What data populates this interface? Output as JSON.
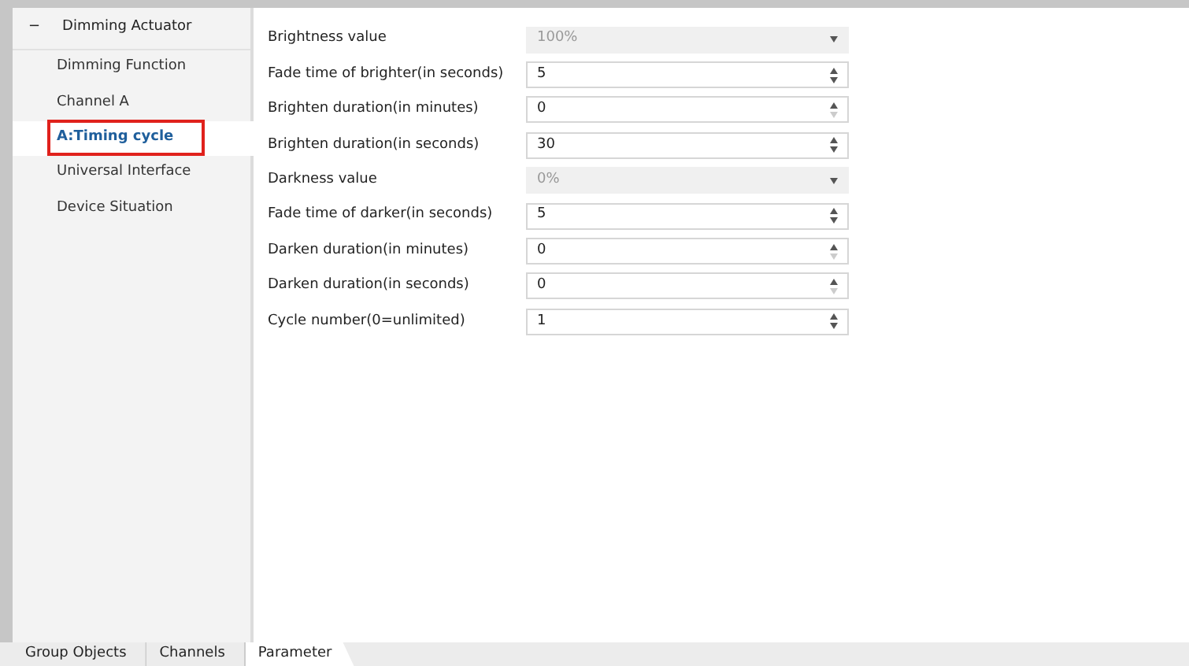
{
  "sidebar": {
    "header": {
      "toggle": "−",
      "label": "Dimming Actuator"
    },
    "items": [
      {
        "label": "Dimming Function",
        "selected": false,
        "highlighted": false
      },
      {
        "label": "Channel A",
        "selected": false,
        "highlighted": false
      },
      {
        "label": "A:Timing cycle",
        "selected": true,
        "highlighted": true
      },
      {
        "label": "Universal Interface",
        "selected": false,
        "highlighted": false
      },
      {
        "label": "Device Situation",
        "selected": false,
        "highlighted": false
      }
    ]
  },
  "parameters": [
    {
      "kind": "select",
      "label": "Brightness value",
      "value": "100%",
      "disabled": true
    },
    {
      "kind": "spin",
      "label": "Fade time of brighter(in seconds)",
      "value": "5",
      "down_disabled": false
    },
    {
      "kind": "spin",
      "label": "Brighten duration(in minutes)",
      "value": "0",
      "down_disabled": true
    },
    {
      "kind": "spin",
      "label": "Brighten duration(in seconds)",
      "value": "30",
      "down_disabled": false
    },
    {
      "kind": "select",
      "label": "Darkness value",
      "value": "0%",
      "disabled": true
    },
    {
      "kind": "spin",
      "label": "Fade time of darker(in seconds)",
      "value": "5",
      "down_disabled": false
    },
    {
      "kind": "spin",
      "label": "Darken duration(in minutes)",
      "value": "0",
      "down_disabled": true
    },
    {
      "kind": "spin",
      "label": "Darken duration(in seconds)",
      "value": "0",
      "down_disabled": true
    },
    {
      "kind": "spin",
      "label": "Cycle number(0=unlimited)",
      "value": "1",
      "down_disabled": false
    }
  ],
  "bottom_tabs": [
    {
      "label": "Group Objects",
      "selected": false
    },
    {
      "label": "Channels",
      "selected": false
    },
    {
      "label": "Parameter",
      "selected": true
    }
  ]
}
